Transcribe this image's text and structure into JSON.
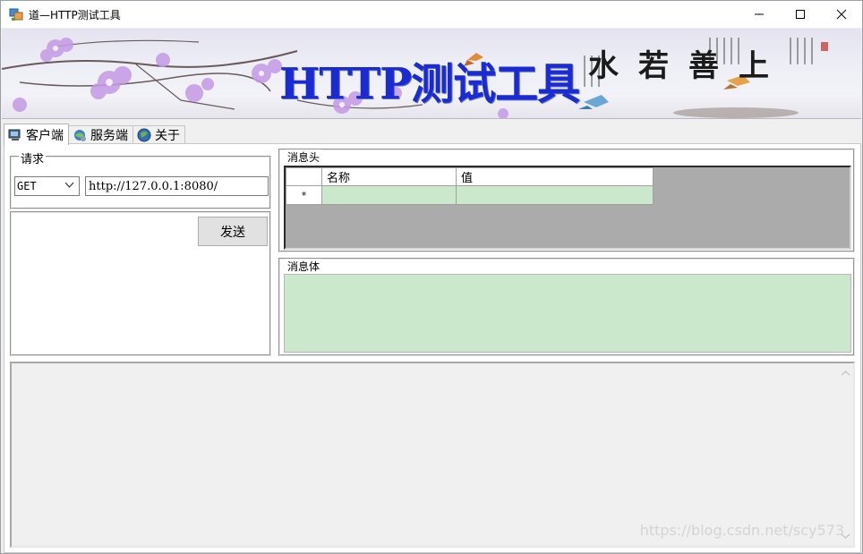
{
  "window": {
    "title": "道—HTTP测试工具",
    "controls": [
      "minimize",
      "maximize",
      "close"
    ]
  },
  "banner": {
    "title": "HTTP测试工具",
    "calligraphy": "水若善上"
  },
  "tabs": [
    {
      "label": "客户端",
      "icon": "client-icon",
      "active": true
    },
    {
      "label": "服务端",
      "icon": "server-icon",
      "active": false
    },
    {
      "label": "关于",
      "icon": "about-icon",
      "active": false
    }
  ],
  "request": {
    "legend": "请求",
    "method": "GET",
    "url": "http://127.0.0.1:8080/",
    "send_label": "发送"
  },
  "headers": {
    "legend": "消息头",
    "columns": [
      "名称",
      "值"
    ],
    "new_row_marker": "*"
  },
  "body": {
    "legend": "消息体"
  },
  "watermark": "https://blog.csdn.net/scy573",
  "colors": {
    "banner_title": "#1a2bd0",
    "grid_cell": "#cce8cc",
    "grid_background": "#ababab"
  }
}
